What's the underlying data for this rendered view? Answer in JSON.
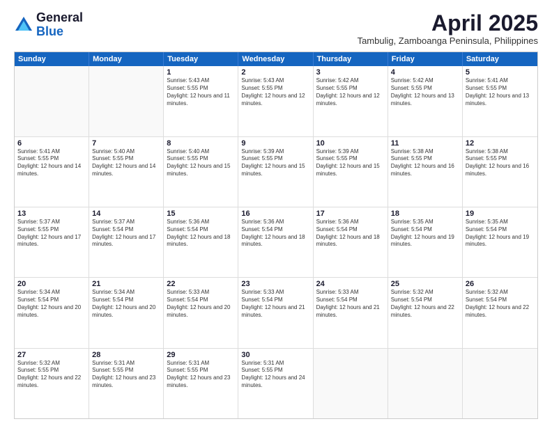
{
  "header": {
    "logo": {
      "line1": "General",
      "line2": "Blue"
    },
    "month": "April 2025",
    "location": "Tambulig, Zamboanga Peninsula, Philippines"
  },
  "weekdays": [
    "Sunday",
    "Monday",
    "Tuesday",
    "Wednesday",
    "Thursday",
    "Friday",
    "Saturday"
  ],
  "weeks": [
    [
      {
        "day": "",
        "sunrise": "",
        "sunset": "",
        "daylight": "",
        "empty": true
      },
      {
        "day": "",
        "sunrise": "",
        "sunset": "",
        "daylight": "",
        "empty": true
      },
      {
        "day": "1",
        "sunrise": "Sunrise: 5:43 AM",
        "sunset": "Sunset: 5:55 PM",
        "daylight": "Daylight: 12 hours and 11 minutes.",
        "empty": false
      },
      {
        "day": "2",
        "sunrise": "Sunrise: 5:43 AM",
        "sunset": "Sunset: 5:55 PM",
        "daylight": "Daylight: 12 hours and 12 minutes.",
        "empty": false
      },
      {
        "day": "3",
        "sunrise": "Sunrise: 5:42 AM",
        "sunset": "Sunset: 5:55 PM",
        "daylight": "Daylight: 12 hours and 12 minutes.",
        "empty": false
      },
      {
        "day": "4",
        "sunrise": "Sunrise: 5:42 AM",
        "sunset": "Sunset: 5:55 PM",
        "daylight": "Daylight: 12 hours and 13 minutes.",
        "empty": false
      },
      {
        "day": "5",
        "sunrise": "Sunrise: 5:41 AM",
        "sunset": "Sunset: 5:55 PM",
        "daylight": "Daylight: 12 hours and 13 minutes.",
        "empty": false
      }
    ],
    [
      {
        "day": "6",
        "sunrise": "Sunrise: 5:41 AM",
        "sunset": "Sunset: 5:55 PM",
        "daylight": "Daylight: 12 hours and 14 minutes.",
        "empty": false
      },
      {
        "day": "7",
        "sunrise": "Sunrise: 5:40 AM",
        "sunset": "Sunset: 5:55 PM",
        "daylight": "Daylight: 12 hours and 14 minutes.",
        "empty": false
      },
      {
        "day": "8",
        "sunrise": "Sunrise: 5:40 AM",
        "sunset": "Sunset: 5:55 PM",
        "daylight": "Daylight: 12 hours and 15 minutes.",
        "empty": false
      },
      {
        "day": "9",
        "sunrise": "Sunrise: 5:39 AM",
        "sunset": "Sunset: 5:55 PM",
        "daylight": "Daylight: 12 hours and 15 minutes.",
        "empty": false
      },
      {
        "day": "10",
        "sunrise": "Sunrise: 5:39 AM",
        "sunset": "Sunset: 5:55 PM",
        "daylight": "Daylight: 12 hours and 15 minutes.",
        "empty": false
      },
      {
        "day": "11",
        "sunrise": "Sunrise: 5:38 AM",
        "sunset": "Sunset: 5:55 PM",
        "daylight": "Daylight: 12 hours and 16 minutes.",
        "empty": false
      },
      {
        "day": "12",
        "sunrise": "Sunrise: 5:38 AM",
        "sunset": "Sunset: 5:55 PM",
        "daylight": "Daylight: 12 hours and 16 minutes.",
        "empty": false
      }
    ],
    [
      {
        "day": "13",
        "sunrise": "Sunrise: 5:37 AM",
        "sunset": "Sunset: 5:55 PM",
        "daylight": "Daylight: 12 hours and 17 minutes.",
        "empty": false
      },
      {
        "day": "14",
        "sunrise": "Sunrise: 5:37 AM",
        "sunset": "Sunset: 5:54 PM",
        "daylight": "Daylight: 12 hours and 17 minutes.",
        "empty": false
      },
      {
        "day": "15",
        "sunrise": "Sunrise: 5:36 AM",
        "sunset": "Sunset: 5:54 PM",
        "daylight": "Daylight: 12 hours and 18 minutes.",
        "empty": false
      },
      {
        "day": "16",
        "sunrise": "Sunrise: 5:36 AM",
        "sunset": "Sunset: 5:54 PM",
        "daylight": "Daylight: 12 hours and 18 minutes.",
        "empty": false
      },
      {
        "day": "17",
        "sunrise": "Sunrise: 5:36 AM",
        "sunset": "Sunset: 5:54 PM",
        "daylight": "Daylight: 12 hours and 18 minutes.",
        "empty": false
      },
      {
        "day": "18",
        "sunrise": "Sunrise: 5:35 AM",
        "sunset": "Sunset: 5:54 PM",
        "daylight": "Daylight: 12 hours and 19 minutes.",
        "empty": false
      },
      {
        "day": "19",
        "sunrise": "Sunrise: 5:35 AM",
        "sunset": "Sunset: 5:54 PM",
        "daylight": "Daylight: 12 hours and 19 minutes.",
        "empty": false
      }
    ],
    [
      {
        "day": "20",
        "sunrise": "Sunrise: 5:34 AM",
        "sunset": "Sunset: 5:54 PM",
        "daylight": "Daylight: 12 hours and 20 minutes.",
        "empty": false
      },
      {
        "day": "21",
        "sunrise": "Sunrise: 5:34 AM",
        "sunset": "Sunset: 5:54 PM",
        "daylight": "Daylight: 12 hours and 20 minutes.",
        "empty": false
      },
      {
        "day": "22",
        "sunrise": "Sunrise: 5:33 AM",
        "sunset": "Sunset: 5:54 PM",
        "daylight": "Daylight: 12 hours and 20 minutes.",
        "empty": false
      },
      {
        "day": "23",
        "sunrise": "Sunrise: 5:33 AM",
        "sunset": "Sunset: 5:54 PM",
        "daylight": "Daylight: 12 hours and 21 minutes.",
        "empty": false
      },
      {
        "day": "24",
        "sunrise": "Sunrise: 5:33 AM",
        "sunset": "Sunset: 5:54 PM",
        "daylight": "Daylight: 12 hours and 21 minutes.",
        "empty": false
      },
      {
        "day": "25",
        "sunrise": "Sunrise: 5:32 AM",
        "sunset": "Sunset: 5:54 PM",
        "daylight": "Daylight: 12 hours and 22 minutes.",
        "empty": false
      },
      {
        "day": "26",
        "sunrise": "Sunrise: 5:32 AM",
        "sunset": "Sunset: 5:54 PM",
        "daylight": "Daylight: 12 hours and 22 minutes.",
        "empty": false
      }
    ],
    [
      {
        "day": "27",
        "sunrise": "Sunrise: 5:32 AM",
        "sunset": "Sunset: 5:55 PM",
        "daylight": "Daylight: 12 hours and 22 minutes.",
        "empty": false
      },
      {
        "day": "28",
        "sunrise": "Sunrise: 5:31 AM",
        "sunset": "Sunset: 5:55 PM",
        "daylight": "Daylight: 12 hours and 23 minutes.",
        "empty": false
      },
      {
        "day": "29",
        "sunrise": "Sunrise: 5:31 AM",
        "sunset": "Sunset: 5:55 PM",
        "daylight": "Daylight: 12 hours and 23 minutes.",
        "empty": false
      },
      {
        "day": "30",
        "sunrise": "Sunrise: 5:31 AM",
        "sunset": "Sunset: 5:55 PM",
        "daylight": "Daylight: 12 hours and 24 minutes.",
        "empty": false
      },
      {
        "day": "",
        "sunrise": "",
        "sunset": "",
        "daylight": "",
        "empty": true
      },
      {
        "day": "",
        "sunrise": "",
        "sunset": "",
        "daylight": "",
        "empty": true
      },
      {
        "day": "",
        "sunrise": "",
        "sunset": "",
        "daylight": "",
        "empty": true
      }
    ]
  ]
}
